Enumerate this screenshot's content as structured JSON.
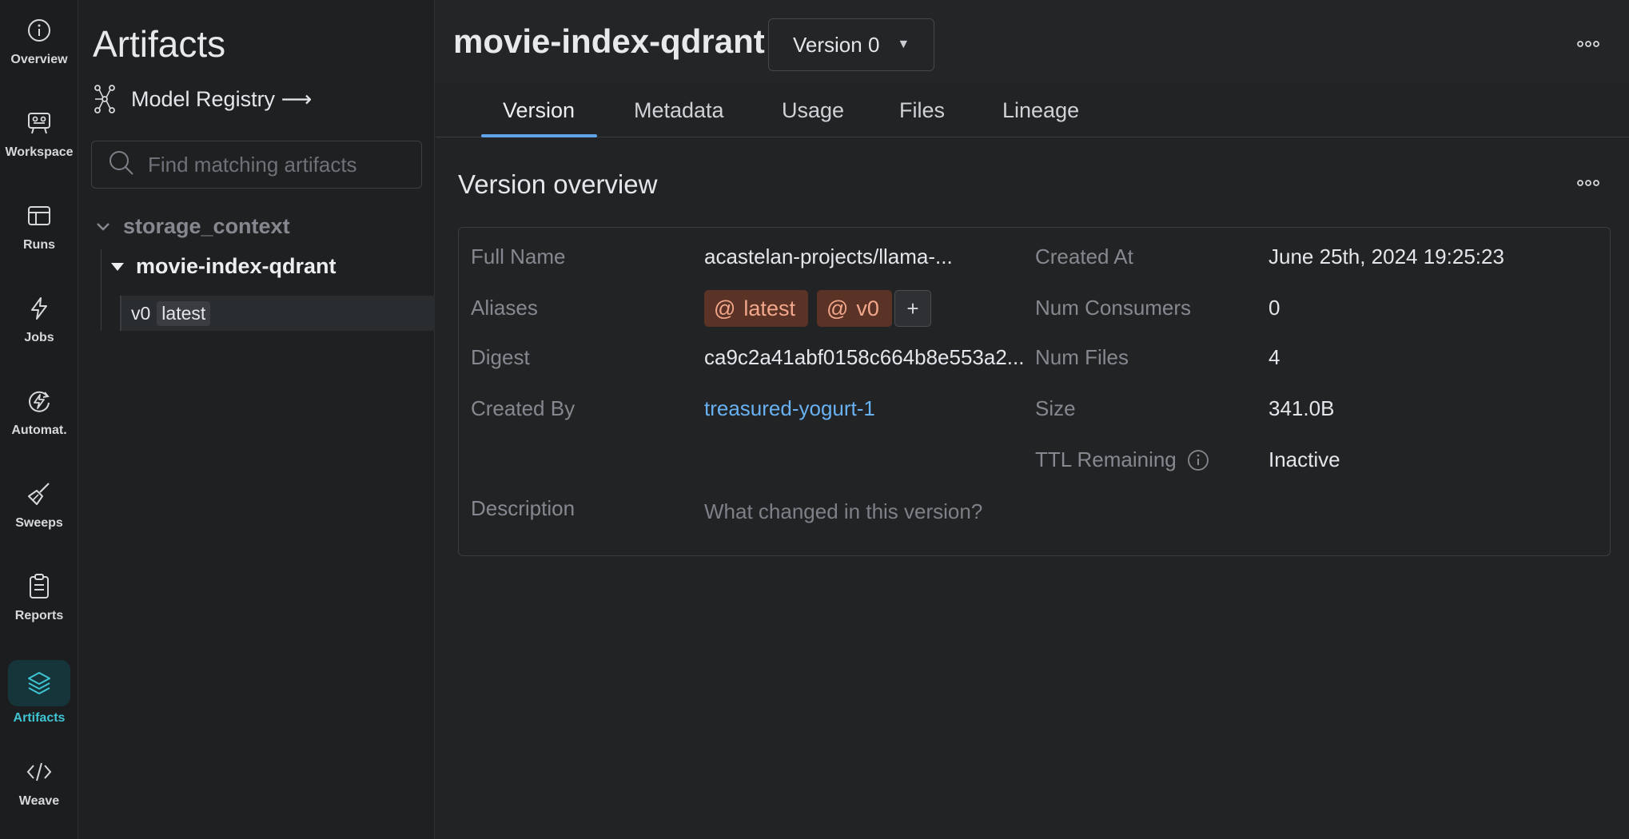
{
  "rail": [
    {
      "label": "Overview",
      "icon": "info-icon"
    },
    {
      "label": "Workspace",
      "icon": "workspace-icon"
    },
    {
      "label": "Runs",
      "icon": "runs-table-icon"
    },
    {
      "label": "Jobs",
      "icon": "lightning-icon"
    },
    {
      "label": "Automat.",
      "icon": "automation-icon"
    },
    {
      "label": "Sweeps",
      "icon": "broom-icon"
    },
    {
      "label": "Reports",
      "icon": "clipboard-icon"
    },
    {
      "label": "Artifacts",
      "icon": "layers-icon",
      "active": true
    },
    {
      "label": "Weave",
      "icon": "code-icon"
    }
  ],
  "sidebar": {
    "title": "Artifacts",
    "registry_link": "Model Registry ⟶",
    "search_placeholder": "Find matching artifacts",
    "group": "storage_context",
    "artifact": "movie-index-qdrant",
    "version": "v0",
    "version_tag": "latest"
  },
  "header": {
    "title": "movie-index-qdrant",
    "version_select": "Version 0"
  },
  "tabs": [
    "Version",
    "Metadata",
    "Usage",
    "Files",
    "Lineage"
  ],
  "overview": {
    "title": "Version overview",
    "fields": {
      "full_name_label": "Full Name",
      "full_name": "acastelan-projects/llama-...",
      "aliases_label": "Aliases",
      "aliases": [
        "latest",
        "v0"
      ],
      "add_alias": "+",
      "digest_label": "Digest",
      "digest": "ca9c2a41abf0158c664b8e553a2...",
      "created_by_label": "Created By",
      "created_by": "treasured-yogurt-1",
      "description_label": "Description",
      "description_placeholder": "What changed in this version?",
      "created_at_label": "Created At",
      "created_at": "June 25th, 2024 19:25:23",
      "num_consumers_label": "Num Consumers",
      "num_consumers": "0",
      "num_files_label": "Num Files",
      "num_files": "4",
      "size_label": "Size",
      "size": "341.0B",
      "ttl_label": "TTL Remaining",
      "ttl": "Inactive"
    }
  },
  "colors": {
    "accent_active": "#3fc4d2",
    "tab_underline": "#5fa3e8",
    "link": "#68b1f2",
    "alias_bg": "#5a3226",
    "alias_text": "#f3a78a"
  }
}
